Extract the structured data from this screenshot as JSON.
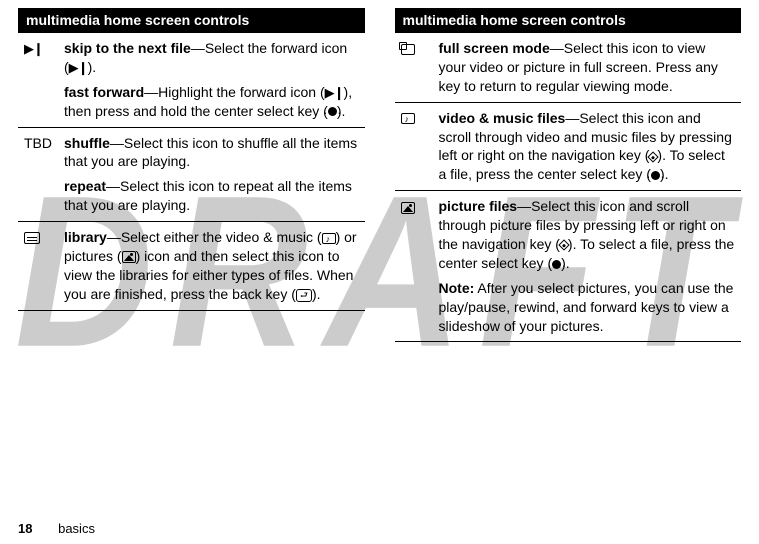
{
  "watermark": "DRAFT",
  "left": {
    "header": "multimedia home screen controls",
    "rows": [
      {
        "icon_label": "▶❙",
        "body_html": [
          {
            "b": "skip to the next file",
            "t": "—Select the forward icon (▶❙)."
          },
          {
            "b": "fast forward",
            "t": "—Highlight the forward icon (▶❙), then press and hold the center select key (●)."
          }
        ]
      },
      {
        "icon_label": "TBD",
        "body_html": [
          {
            "b": "shuffle",
            "t": "—Select this icon to shuffle all the items that you are playing."
          },
          {
            "b": "repeat",
            "t": "—Select this icon to repeat all the items that you are playing."
          }
        ]
      },
      {
        "icon_label": "library",
        "body_html": [
          {
            "b": "library",
            "t": "—Select either the video & music (▣) or pictures (▣) icon and then select this icon to view the libraries for either types of files. When you are finished, press the back key (⮐)."
          }
        ]
      }
    ]
  },
  "right": {
    "header": "multimedia home screen controls",
    "rows": [
      {
        "icon_label": "fullscreen",
        "body_html": [
          {
            "b": "full screen mode",
            "t": "—Select this icon to view your video or picture in full screen. Press any key to return to regular viewing mode."
          }
        ]
      },
      {
        "icon_label": "video-music",
        "body_html": [
          {
            "b": "video & music files",
            "t": "—Select this icon and scroll through video and music files by pressing left or right on the navigation key (◆). To select a file, press the center select key (●)."
          }
        ]
      },
      {
        "icon_label": "pictures",
        "body_html": [
          {
            "b": "picture files",
            "t": "—Select this icon and scroll through picture files by pressing left or right on the navigation key (◆). To select a file, press the center select key (●)."
          },
          {
            "b": "Note:",
            "t": " After you select pictures, you can use the play/pause, rewind, and forward keys to view a slideshow of your pictures."
          }
        ]
      }
    ]
  },
  "footer": {
    "page": "18",
    "section": "basics"
  }
}
